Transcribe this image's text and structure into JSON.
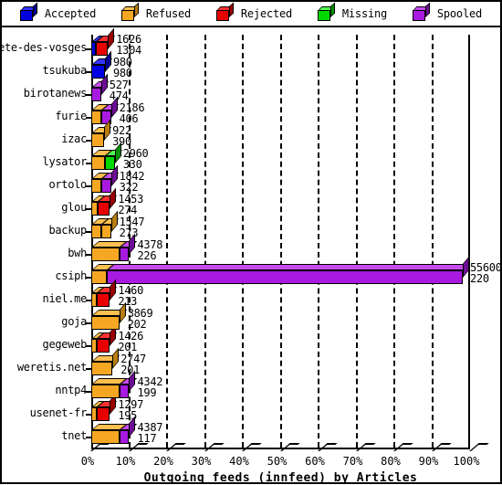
{
  "legend": {
    "items": [
      {
        "label": "Accepted",
        "color": "#0000e0",
        "top": "#3333ff",
        "side": "#000090",
        "icon": "cube-icon"
      },
      {
        "label": "Refused",
        "color": "#f5a723",
        "top": "#ffc050",
        "side": "#b87d10",
        "icon": "cube-icon"
      },
      {
        "label": "Rejected",
        "color": "#e80000",
        "top": "#ff3030",
        "side": "#990000",
        "icon": "cube-icon"
      },
      {
        "label": "Missing",
        "color": "#00d800",
        "top": "#50ff50",
        "side": "#009000",
        "icon": "cube-icon"
      },
      {
        "label": "Spooled",
        "color": "#a81ae0",
        "top": "#c64cf0",
        "side": "#6d0f96",
        "icon": "cube-icon"
      }
    ]
  },
  "axis": {
    "x_title": "Outgoing feeds (innfeed) by Articles",
    "x_ticks": [
      "0%",
      "10%",
      "20%",
      "30%",
      "40%",
      "50%",
      "60%",
      "70%",
      "80%",
      "90%",
      "100%"
    ]
  },
  "chart_data": {
    "type": "bar",
    "orientation": "horizontal",
    "title": "Outgoing feeds (innfeed) by Articles",
    "xlabel": "Outgoing feeds (innfeed) by Articles",
    "ylabel": "",
    "xlim": [
      0,
      100
    ],
    "x_unit": "percent",
    "grid": true,
    "legend_position": "top",
    "legend_entries": [
      "Accepted",
      "Refused",
      "Rejected",
      "Missing",
      "Spooled"
    ],
    "categories": [
      "bete-des-vosges",
      "tsukuba",
      "birotanews",
      "furie",
      "izac",
      "lysator",
      "ortolo",
      "glou",
      "backup",
      "bwh",
      "csiph",
      "niel.me",
      "goja",
      "gegeweb",
      "weretis.net",
      "nntp4",
      "usenet-fr",
      "tnet"
    ],
    "value_labels_primary": [
      1626,
      980,
      527,
      2186,
      922,
      2960,
      1842,
      1453,
      1547,
      4378,
      55600,
      1460,
      3869,
      1426,
      2747,
      4342,
      1297,
      4387
    ],
    "value_labels_secondary": [
      1304,
      980,
      474,
      406,
      390,
      330,
      322,
      274,
      273,
      226,
      220,
      213,
      202,
      201,
      201,
      199,
      195,
      117
    ],
    "rows": [
      {
        "label": "bete-des-vosges",
        "primary": 1626,
        "secondary": 1304,
        "segments": [
          {
            "name": "Accepted",
            "percent": 1.3
          },
          {
            "name": "Rejected",
            "percent": 3.1
          }
        ]
      },
      {
        "label": "tsukuba",
        "primary": 980,
        "secondary": 980,
        "segments": [
          {
            "name": "Accepted",
            "percent": 3.6
          }
        ]
      },
      {
        "label": "birotanews",
        "primary": 527,
        "secondary": 474,
        "segments": [
          {
            "name": "Spooled",
            "percent": 2.6
          }
        ]
      },
      {
        "label": "furie",
        "primary": 2186,
        "secondary": 406,
        "segments": [
          {
            "name": "Refused",
            "percent": 2.6
          },
          {
            "name": "Spooled",
            "percent": 2.6
          }
        ]
      },
      {
        "label": "izac",
        "primary": 922,
        "secondary": 390,
        "segments": [
          {
            "name": "Refused",
            "percent": 3.4
          }
        ]
      },
      {
        "label": "lysator",
        "primary": 2960,
        "secondary": 330,
        "segments": [
          {
            "name": "Refused",
            "percent": 3.6
          },
          {
            "name": "Missing",
            "percent": 2.6
          }
        ]
      },
      {
        "label": "ortolo",
        "primary": 1842,
        "secondary": 322,
        "segments": [
          {
            "name": "Refused",
            "percent": 2.6
          },
          {
            "name": "Spooled",
            "percent": 2.6
          }
        ]
      },
      {
        "label": "glou",
        "primary": 1453,
        "secondary": 274,
        "segments": [
          {
            "name": "Refused",
            "percent": 1.8
          },
          {
            "name": "Rejected",
            "percent": 3.1
          }
        ]
      },
      {
        "label": "backup",
        "primary": 1547,
        "secondary": 273,
        "segments": [
          {
            "name": "Refused",
            "percent": 2.6
          },
          {
            "name": "Refused",
            "percent": 2.6
          }
        ]
      },
      {
        "label": "bwh",
        "primary": 4378,
        "secondary": 226,
        "segments": [
          {
            "name": "Refused",
            "percent": 7.4
          },
          {
            "name": "Spooled",
            "percent": 2.6
          }
        ]
      },
      {
        "label": "csiph",
        "primary": 55600,
        "secondary": 220,
        "segments": [
          {
            "name": "Refused",
            "percent": 4.2
          },
          {
            "name": "Spooled",
            "percent": 93.8
          }
        ]
      },
      {
        "label": "niel.me",
        "primary": 1460,
        "secondary": 213,
        "segments": [
          {
            "name": "Refused",
            "percent": 1.5
          },
          {
            "name": "Rejected",
            "percent": 3.4
          }
        ]
      },
      {
        "label": "goja",
        "primary": 3869,
        "secondary": 202,
        "segments": [
          {
            "name": "Refused",
            "percent": 7.4
          }
        ]
      },
      {
        "label": "gegeweb",
        "primary": 1426,
        "secondary": 201,
        "segments": [
          {
            "name": "Refused",
            "percent": 1.5
          },
          {
            "name": "Rejected",
            "percent": 3.4
          }
        ]
      },
      {
        "label": "weretis.net",
        "primary": 2747,
        "secondary": 201,
        "segments": [
          {
            "name": "Refused",
            "percent": 5.6
          }
        ]
      },
      {
        "label": "nntp4",
        "primary": 4342,
        "secondary": 199,
        "segments": [
          {
            "name": "Refused",
            "percent": 7.4
          },
          {
            "name": "Spooled",
            "percent": 2.6
          }
        ]
      },
      {
        "label": "usenet-fr",
        "primary": 1297,
        "secondary": 195,
        "segments": [
          {
            "name": "Refused",
            "percent": 1.5
          },
          {
            "name": "Rejected",
            "percent": 3.4
          }
        ]
      },
      {
        "label": "tnet",
        "primary": 4387,
        "secondary": 117,
        "segments": [
          {
            "name": "Refused",
            "percent": 7.4
          },
          {
            "name": "Spooled",
            "percent": 2.6
          }
        ]
      }
    ]
  }
}
